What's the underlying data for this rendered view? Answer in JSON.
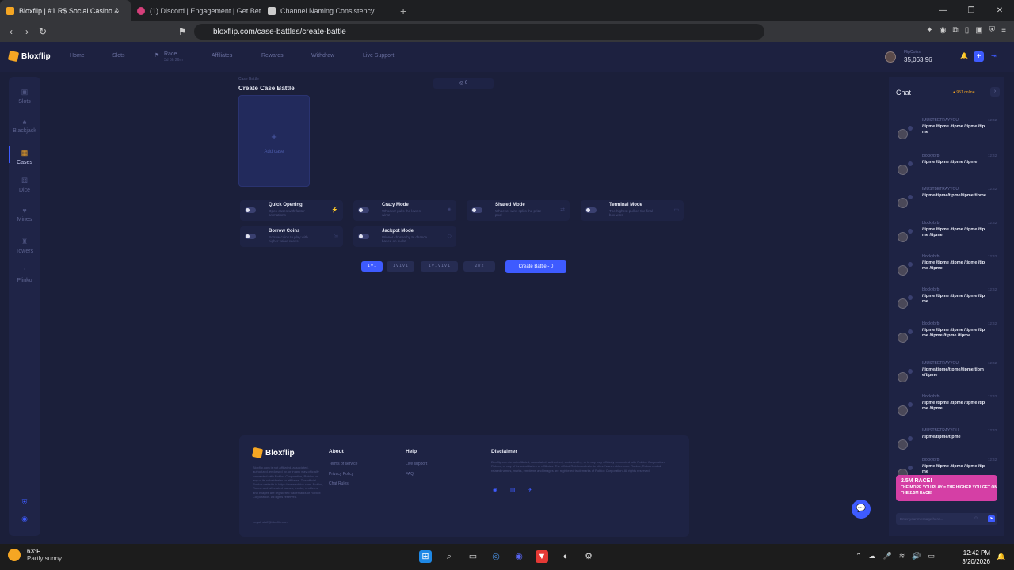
{
  "browser": {
    "tabs": [
      {
        "title": "Bloxflip | #1 R$ Social Casino & ...",
        "active": true,
        "color": "#f5a623"
      },
      {
        "title": "(1) Discord | Engagement | Get Bet",
        "active": false,
        "color": "#d53f7a"
      },
      {
        "title": "Channel Naming Consistency",
        "active": false,
        "color": "#cccccc"
      }
    ],
    "url": "bloxflip.com/case-battles/create-battle"
  },
  "site": {
    "logo": "Bloxflip",
    "nav": [
      "Home",
      "Slots",
      "Race",
      "Affiliates",
      "Rewards",
      "Withdraw",
      "Live Support"
    ],
    "race_sub": "3d 5h 26m",
    "flipcoins_label": "FlipCoins",
    "balance": "35,063.96",
    "sidebar": [
      {
        "label": "Slots",
        "icon": "▣"
      },
      {
        "label": "Blackjack",
        "icon": "♠"
      },
      {
        "label": "Cases",
        "icon": "▦",
        "active": true
      },
      {
        "label": "Dice",
        "icon": "⚄"
      },
      {
        "label": "Mines",
        "icon": "♥"
      },
      {
        "label": "Towers",
        "icon": "♜"
      },
      {
        "label": "Plinko",
        "icon": "∴"
      }
    ]
  },
  "battle": {
    "breadcrumb": "Case Battle",
    "title": "Create Case Battle",
    "counter": "0",
    "add_case_label": "Add case",
    "modes": [
      {
        "title": "Quick Opening",
        "desc": "Open cases with faster animations"
      },
      {
        "title": "Crazy Mode",
        "desc": "Whoever pulls the lowest wins!"
      },
      {
        "title": "Shared Mode",
        "desc": "Whoever wins splits the prize pool"
      },
      {
        "title": "Terminal Mode",
        "desc": "The highest pull on the final box wins"
      },
      {
        "title": "Borrow Coins",
        "desc": "Borrow coins to play with higher value cases"
      },
      {
        "title": "Jackpot Mode",
        "desc": "Winner chosen by % chance based on pulls!"
      }
    ],
    "teams": [
      "1 v 1",
      "1 v 1 v 1",
      "1 v 1 v 1 v 1",
      "2 v 2"
    ],
    "create_label": "Create Battle - 0"
  },
  "footer": {
    "logo": "Bloxflip",
    "blurb": "Bloxflip.com is not affiliated, associated, authorized, endorsed by, or in any way officially connected with Roblox Corporation, Roblox, or any of its subsidiaries or affiliates. The official Roblox website is https://www.roblox.com. Roblox, Robux and all related names, marks, emblems and images are registered trademarks of Roblox Corporation. All rights reserved.",
    "legal": "Legal: staff@bloxflip.com",
    "about_title": "About",
    "about_links": [
      "Terms of service",
      "Privacy Policy",
      "Chat Rules"
    ],
    "help_title": "Help",
    "help_links": [
      "Live support",
      "FAQ"
    ],
    "disclaimer_title": "Disclaimer",
    "disclaimer": "Bloxflip.com is not affiliated, associated, authorized, endorsed by, or in any way officially connected with Roblox Corporation, Roblox, or any of its subsidiaries or affiliates. The official Roblox website is https://www.roblox.com. Roblox, Robux and all related names, marks, emblems and images are registered trademarks of Roblox Corporation. All rights reserved."
  },
  "chat": {
    "title": "Chat",
    "online": "951 online",
    "messages": [
      {
        "user": "IMUSTBETRAYYOU",
        "time": "12:42",
        "text": "/tipme /tipme /tipme /tipme /tipme"
      },
      {
        "user": "blockybrb",
        "time": "12:42",
        "text": "/tipme /tipme /tipme /tipme"
      },
      {
        "user": "IMUSTBETRAYYOU",
        "time": "12:42",
        "text": "/tipme/tipme/tipme/tipme/tipme"
      },
      {
        "user": "blockybrb",
        "time": "12:42",
        "text": "/tipme /tipme /tipme /tipme /tipme /tipme"
      },
      {
        "user": "blockybrb",
        "time": "12:42",
        "text": "/tipme /tipme /tipme /tipme /tipme /tipme"
      },
      {
        "user": "blockybrb",
        "time": "12:42",
        "text": "/tipme /tipme /tipme /tipme /tipme"
      },
      {
        "user": "blockybrb",
        "time": "12:42",
        "text": "/tipme /tipme /tipme /tipme /tipme /tipme /tipme /tipme"
      },
      {
        "user": "IMUSTBETRAYYOU",
        "time": "12:42",
        "text": "/tipme/tipme/tipme/tipme/tipme/tipme"
      },
      {
        "user": "blockybrb",
        "time": "12:42",
        "text": "/tipme /tipme /tipme /tipme /tipme /tipme"
      },
      {
        "user": "IMUSTBETRAYYOU",
        "time": "12:42",
        "text": "/tipme/tipme/tipme"
      },
      {
        "user": "blockybrb",
        "time": "12:42",
        "text": "/tipme /tipme /tipme /tipme /tipme"
      }
    ],
    "race_title": "2.5M RACE!",
    "race_sub": "THE MORE YOU PLAY = THE HIGHER YOU GET ON THE 2.5M RACE!",
    "input_placeholder": "Enter your message here..."
  },
  "taskbar": {
    "temp": "63°F",
    "weather": "Partly sunny",
    "time": "12:42 PM",
    "date": "3/20/2026"
  }
}
